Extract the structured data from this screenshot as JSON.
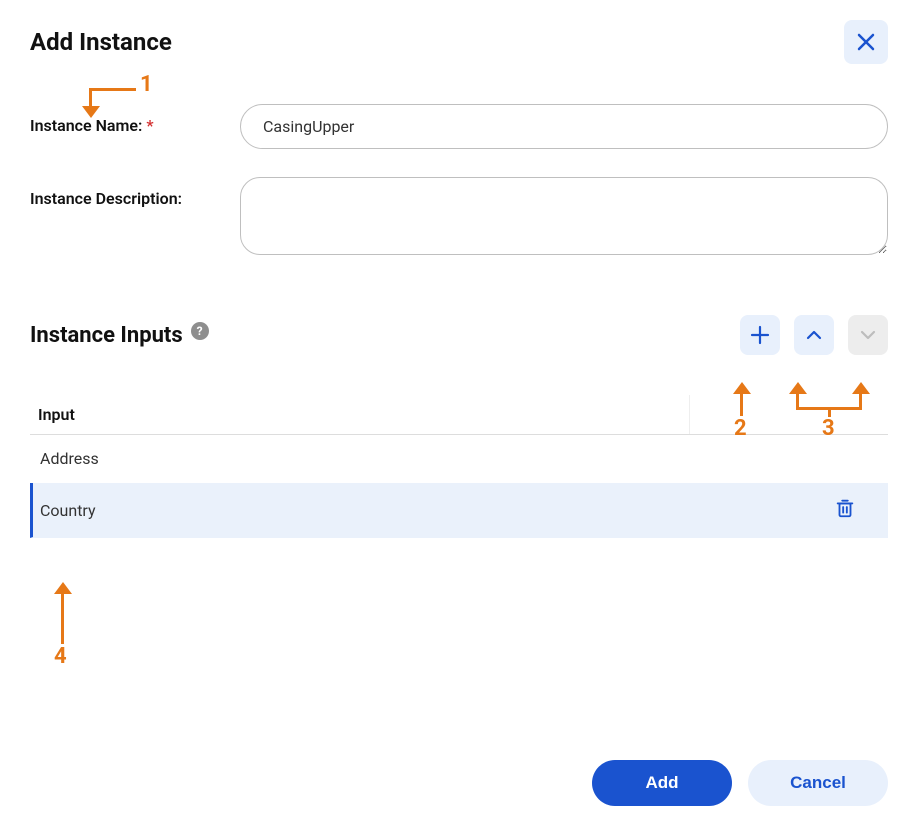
{
  "header": {
    "title": "Add Instance"
  },
  "form": {
    "name_label": "Instance Name:",
    "name_value": "CasingUpper",
    "desc_label": "Instance Description:",
    "desc_value": ""
  },
  "inputs_section": {
    "title": "Instance Inputs",
    "column_header": "Input",
    "rows": [
      {
        "label": "Address",
        "selected": false
      },
      {
        "label": "Country",
        "selected": true
      }
    ]
  },
  "footer": {
    "add_label": "Add",
    "cancel_label": "Cancel"
  },
  "annotations": {
    "n1": "1",
    "n2": "2",
    "n3": "3",
    "n4": "4"
  }
}
